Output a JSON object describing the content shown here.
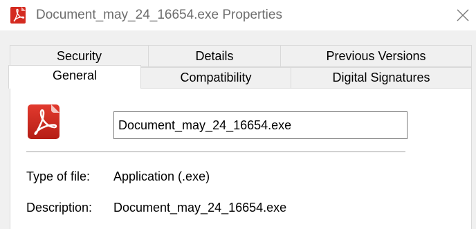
{
  "window": {
    "title": "Document_may_24_16654.exe Properties",
    "close_icon": "close-icon"
  },
  "tabs": {
    "row1": [
      {
        "label": "Security"
      },
      {
        "label": "Details"
      },
      {
        "label": "Previous Versions"
      }
    ],
    "row2": [
      {
        "label": "General",
        "selected": true
      },
      {
        "label": "Compatibility"
      },
      {
        "label": "Digital Signatures"
      }
    ]
  },
  "general": {
    "file_icon": "pdf-icon",
    "file_name": "Document_may_24_16654.exe",
    "properties": [
      {
        "label": "Type of file:",
        "value": "Application (.exe)"
      },
      {
        "label": "Description:",
        "value": "Document_may_24_16654.exe"
      }
    ]
  },
  "colors": {
    "icon_red": "#d42a20",
    "panel_bg": "#ffffff",
    "window_bg": "#f0f0f0"
  }
}
